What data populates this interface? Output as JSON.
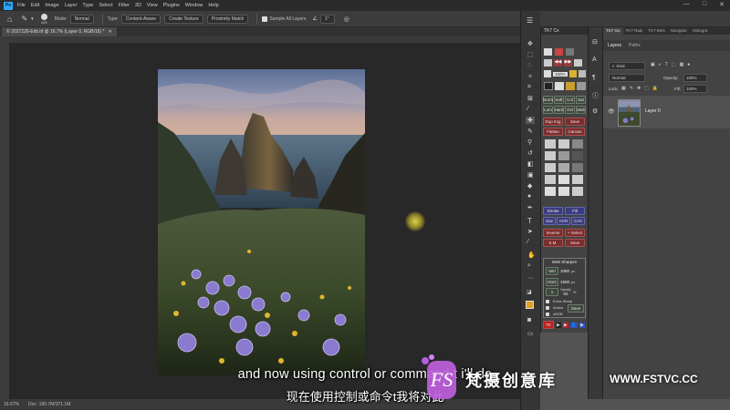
{
  "app": {
    "logo": "Ps"
  },
  "menu": [
    "File",
    "Edit",
    "Image",
    "Layer",
    "Type",
    "Select",
    "Filter",
    "3D",
    "View",
    "Plugins",
    "Window",
    "Help"
  ],
  "options": {
    "brush_size": "125",
    "mode_label": "Mode:",
    "mode_value": "Normal",
    "type_label": "Type:",
    "type_content_aware": "Content-Aware",
    "type_create_texture": "Create Texture",
    "type_proximity_match": "Proximity Match",
    "sample_all_layers": "Sample All Layers",
    "angle": "1°"
  },
  "document": {
    "tab_title": "© 2037226-Edit.tif @ 16.7% (Layer 0, RGB/16) *"
  },
  "status": {
    "zoom": "16.67%",
    "doc_size": "Doc: 180.7M/371.1M"
  },
  "tk7": {
    "title": "TK7 Cx",
    "zoom": "100%",
    "buttons": [
      "Norm",
      "Soft",
      "Col",
      "Sat",
      "Lum",
      "Hard",
      "Ovl",
      "Mult",
      "Dup Img",
      "Save",
      "Flatten",
      "Canvas",
      "Stroke",
      "Fill",
      "Sav",
      "ACR",
      "CAV",
      "Inverse",
      "+ Select",
      "S.M.",
      "Save"
    ],
    "websharpen": {
      "title": "Web Sharpen",
      "vert_label": "Vert",
      "vert_value": "1080",
      "horz_label": "Horz",
      "horz_value": "1500",
      "unit": "px",
      "opacity_label": "Opacity",
      "opacity_value": "50",
      "pct": "%",
      "extra_sharp": "Extra Sharp",
      "action": "Action",
      "srgb": "sRGB",
      "save": "Save"
    },
    "footer": "TK"
  },
  "layers_panel": {
    "top_tabs": [
      "TK7 Go",
      "TK7 Rapi",
      "TK7 Bets",
      "Navigato",
      "Histogra"
    ],
    "tabs": [
      "Layers",
      "Paths"
    ],
    "kind": "Kind",
    "blend_mode": "Normal",
    "opacity_label": "Opacity:",
    "opacity_value": "100%",
    "lock_label": "Lock:",
    "fill_label": "Fill:",
    "fill_value": "100%",
    "layer_name": "Layer 0"
  },
  "subtitles": {
    "english": "and now using control or command t i'll do",
    "chinese": "现在使用控制或命令t我将对此"
  },
  "watermark": {
    "brand": "梵摄创意库",
    "url": "WWW.FSTVC.CC",
    "logo_letters": "FS"
  },
  "colors": {
    "accent": "#31a8ff",
    "tk_red": "#7a2d2d",
    "tk_blue": "#3b3d80",
    "cursor": "#f0e040"
  }
}
